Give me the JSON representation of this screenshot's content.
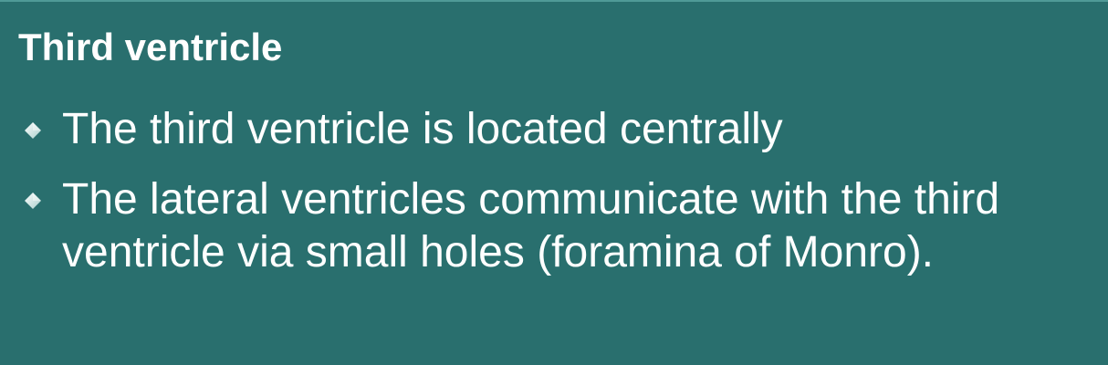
{
  "slide": {
    "title": "Third ventricle",
    "bullets": [
      {
        "icon": "diamond-bullet-icon",
        "text": "The third ventricle is located centrally"
      },
      {
        "icon": "diamond-bullet-icon",
        "text": "The lateral ventricles communicate with the third ventricle via small holes (foramina of Monro)."
      }
    ]
  },
  "colors": {
    "background": "#296f6e",
    "text": "#ffffff",
    "bullet": "#d9eceb"
  }
}
